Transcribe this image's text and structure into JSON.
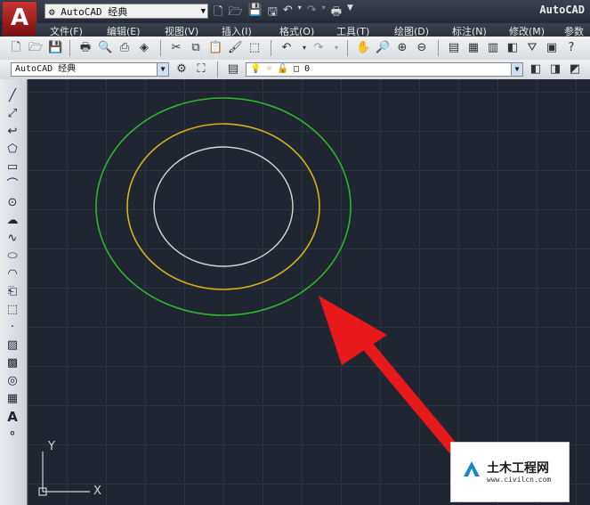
{
  "app": {
    "title": "AutoCAD",
    "logo_letter": "A",
    "workspace": "AutoCAD 经典"
  },
  "menu": [
    "文件(F)",
    "编辑(E)",
    "视图(V)",
    "插入(I)",
    "格式(O)",
    "工具(T)",
    "绘图(D)",
    "标注(N)",
    "修改(M)",
    "参数"
  ],
  "toolbar2": {
    "workspace": "AutoCAD 经典",
    "layer": "0"
  },
  "ucs": {
    "y": "Y",
    "x": "X"
  },
  "watermark": {
    "name": "土木工程网",
    "url": "www.civilcn.com"
  },
  "colors": {
    "outer_circle": "#2db52d",
    "middle_circle": "#d4b21c",
    "inner_circle": "#d8d8d8",
    "arrow": "#e8191b",
    "canvas_bg": "#1f2531"
  }
}
